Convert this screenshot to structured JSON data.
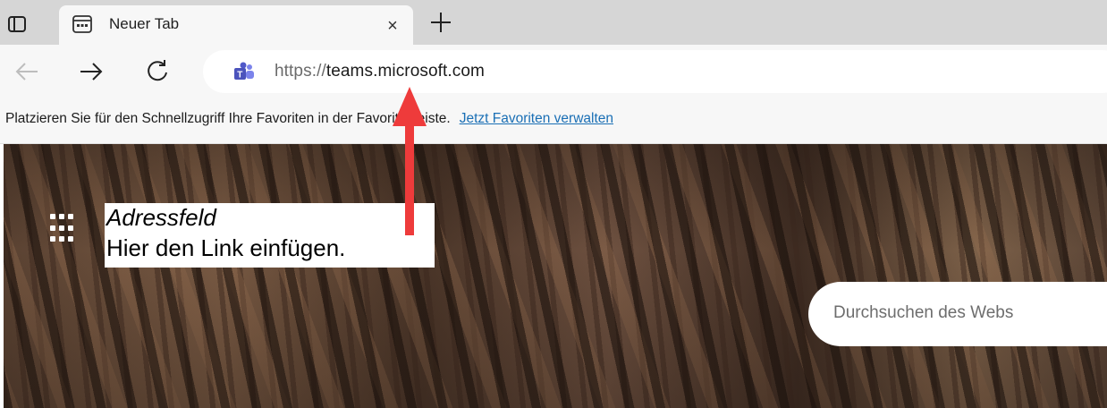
{
  "tab": {
    "title": "Neuer Tab",
    "close_glyph": "×"
  },
  "address_bar": {
    "url_scheme": "https://",
    "url_host": "teams.microsoft.com",
    "site_icon": "teams-icon"
  },
  "favorites_bar": {
    "message": "Platzieren Sie für den Schnellzugriff Ihre Favoriten in der Favoritenleiste.",
    "link": "Jetzt Favoriten verwalten"
  },
  "new_tab_page": {
    "search_placeholder": "Durchsuchen des Webs"
  },
  "annotation": {
    "title": "Adressfeld",
    "text": "Hier den Link einfügen.",
    "arrow_color": "#ee3b3b"
  },
  "icons": [
    "tab-actions-icon",
    "new-tab-page-icon",
    "close-icon",
    "plus-icon",
    "back-arrow-icon",
    "forward-arrow-icon",
    "refresh-icon",
    "teams-icon",
    "apps-grid-icon"
  ]
}
